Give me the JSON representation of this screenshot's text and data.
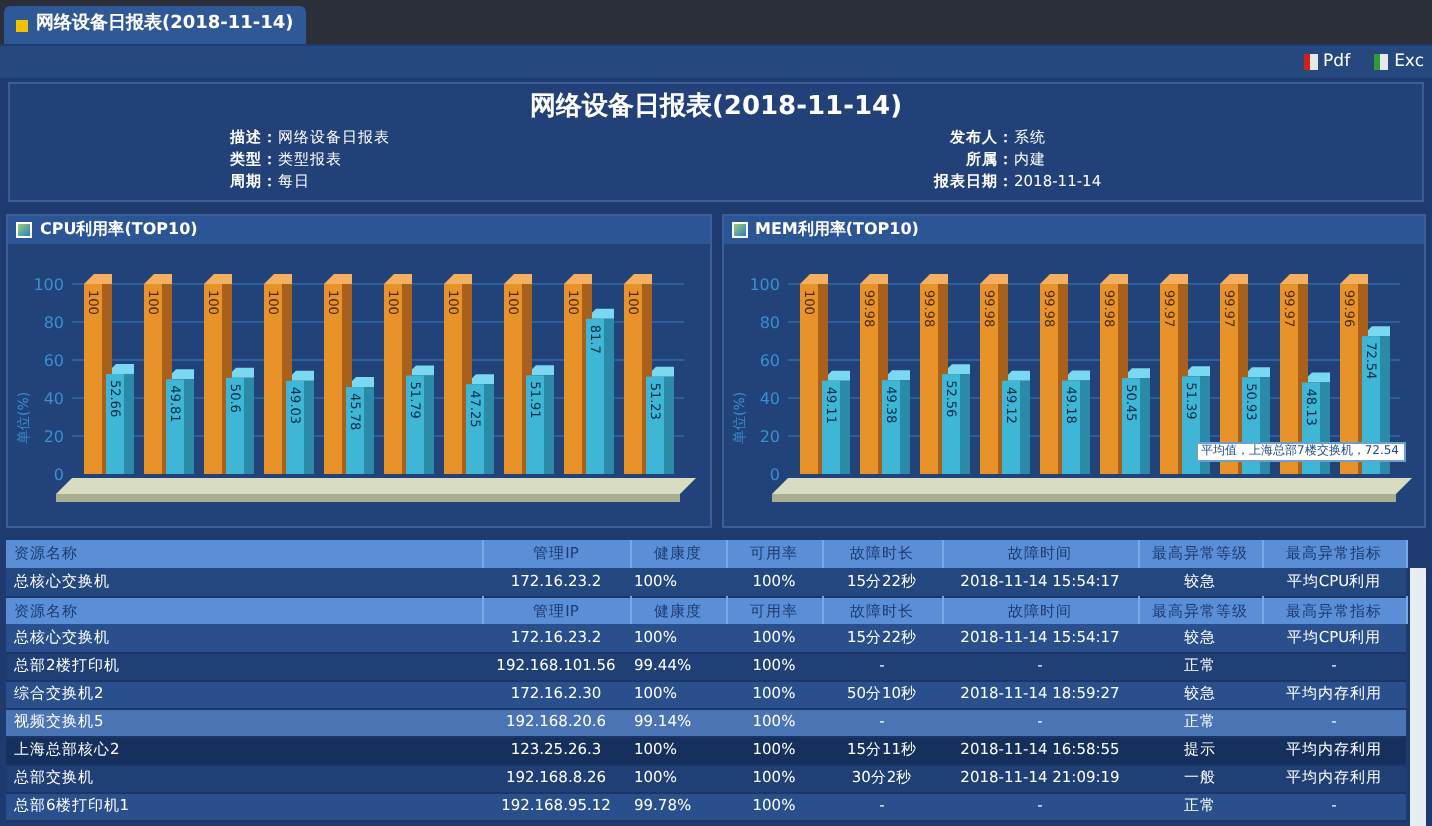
{
  "tabs": [
    {
      "label": "网络设备日报表(2018-11-14)",
      "selected": true
    }
  ],
  "toolbar": [
    {
      "label": "Pdf",
      "kind": "pdf"
    },
    {
      "label": "Exc",
      "kind": "excel"
    }
  ],
  "report": {
    "title": "网络设备日报表(2018-11-14)",
    "meta_left": [
      {
        "label": "描述：",
        "value": "网络设备日报表"
      },
      {
        "label": "类型：",
        "value": "类型报表"
      },
      {
        "label": "周期：",
        "value": "每日"
      }
    ],
    "meta_right": [
      {
        "label": "发布人：",
        "value": "系统"
      },
      {
        "label": "所属：",
        "value": "内建"
      },
      {
        "label": "报表日期：",
        "value": "2018-11-14"
      }
    ]
  },
  "charts": [
    {
      "title": "CPU利用率(TOP10)",
      "chart_data": {
        "type": "bar",
        "grid": true,
        "ylabel": "单位(%)",
        "ylim": [
          0,
          100
        ],
        "yticks": [
          0,
          20,
          40,
          60,
          80,
          100
        ],
        "data_labels": true,
        "series": [
          {
            "color": "#e8922a",
            "values": [
              100,
              100,
              100,
              100,
              100,
              100,
              100,
              100,
              100,
              100
            ]
          },
          {
            "color": "#3fb6d6",
            "values": [
              52.66,
              49.81,
              50.6,
              49.03,
              45.78,
              51.79,
              47.25,
              51.91,
              81.7,
              51.23
            ]
          }
        ]
      }
    },
    {
      "title": "MEM利用率(TOP10)",
      "chart_data": {
        "type": "bar",
        "grid": true,
        "ylabel": "单位(%)",
        "ylim": [
          0,
          100
        ],
        "yticks": [
          0,
          20,
          40,
          60,
          80,
          100
        ],
        "data_labels": true,
        "series": [
          {
            "color": "#e8922a",
            "values": [
              100,
              99.98,
              99.98,
              99.98,
              99.98,
              99.98,
              99.97,
              99.97,
              99.97,
              99.96
            ]
          },
          {
            "color": "#3fb6d6",
            "values": [
              49.11,
              49.38,
              52.56,
              49.12,
              49.18,
              50.45,
              51.39,
              50.93,
              48.13,
              72.54
            ]
          }
        ]
      },
      "tooltip": "平均值，上海总部7楼交换机，72.54"
    }
  ],
  "sticky_header": {
    "columns": [
      "资源名称",
      "管理IP",
      "健康度",
      "可用率",
      "故障时长",
      "故障时间",
      "最高异常等级",
      "最高异常指标"
    ]
  },
  "sticky_row": {
    "cells": [
      "总核心交换机",
      "172.16.23.2",
      "100%",
      "100%",
      "15分22秒",
      "2018-11-14 15:54:17",
      "较急",
      "平均CPU利用"
    ]
  },
  "table": {
    "columns": [
      "资源名称",
      "管理IP",
      "健康度",
      "可用率",
      "故障时长",
      "故障时间",
      "最高异常等级",
      "最高异常指标"
    ],
    "rows": [
      {
        "selected": false,
        "hovered": false,
        "cells": [
          "总核心交换机",
          "172.16.23.2",
          "100%",
          "100%",
          "15分22秒",
          "2018-11-14 15:54:17",
          "较急",
          "平均CPU利用"
        ]
      },
      {
        "selected": false,
        "hovered": false,
        "cells": [
          "总部2楼打印机",
          "192.168.101.56",
          "99.44%",
          "100%",
          "-",
          "-",
          "正常",
          "-"
        ]
      },
      {
        "selected": false,
        "hovered": false,
        "cells": [
          "综合交换机2",
          "172.16.2.30",
          "100%",
          "100%",
          "50分10秒",
          "2018-11-14 18:59:27",
          "较急",
          "平均内存利用"
        ]
      },
      {
        "selected": true,
        "hovered": false,
        "cells": [
          "视频交换机5",
          "192.168.20.6",
          "99.14%",
          "100%",
          "-",
          "-",
          "正常",
          "-"
        ]
      },
      {
        "selected": false,
        "hovered": true,
        "cells": [
          "上海总部核心2",
          "123.25.26.3",
          "100%",
          "100%",
          "15分11秒",
          "2018-11-14 16:58:55",
          "提示",
          "平均内存利用"
        ]
      },
      {
        "selected": false,
        "hovered": false,
        "cells": [
          "总部交换机",
          "192.168.8.26",
          "100%",
          "100%",
          "30分2秒",
          "2018-11-14 21:09:19",
          "一般",
          "平均内存利用"
        ]
      },
      {
        "selected": false,
        "hovered": false,
        "cells": [
          "总部6楼打印机1",
          "192.168.95.12",
          "99.78%",
          "100%",
          "-",
          "-",
          "正常",
          "-"
        ]
      }
    ]
  }
}
